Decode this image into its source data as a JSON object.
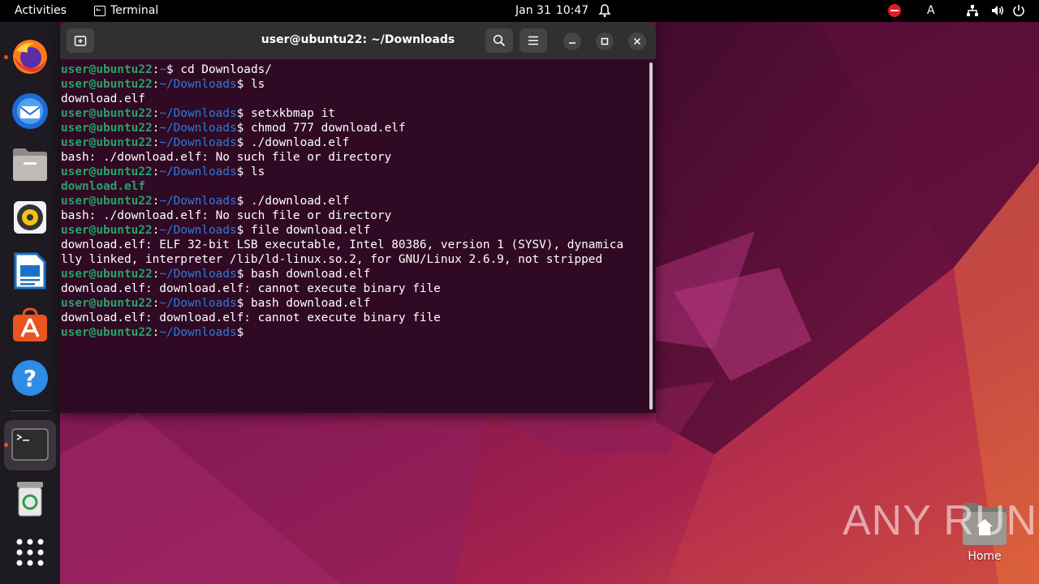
{
  "topbar": {
    "activities": "Activities",
    "app_name": "Terminal",
    "date": "Jan 31",
    "time": "10:47",
    "language": "A",
    "icons": [
      "bell-icon",
      "stop-icon",
      "network-icon",
      "volume-icon",
      "power-icon"
    ]
  },
  "dock": {
    "items": [
      "Firefox",
      "Thunderbird",
      "Files",
      "Rhythmbox",
      "LibreOffice Writer",
      "Ubuntu Software",
      "Help",
      "Terminal",
      "Trash",
      "Show Applications"
    ],
    "running": [
      "Firefox",
      "Terminal"
    ]
  },
  "terminal": {
    "title": "user@ubuntu22: ~/Downloads",
    "lines": [
      {
        "user": "user@ubuntu22",
        "colon": ":",
        "path": "~",
        "prompt": "$ ",
        "text": "cd Downloads/"
      },
      {
        "user": "user@ubuntu22",
        "colon": ":",
        "path": "~/Downloads",
        "prompt": "$ ",
        "text": "ls"
      },
      {
        "text": "download.elf"
      },
      {
        "user": "user@ubuntu22",
        "colon": ":",
        "path": "~/Downloads",
        "prompt": "$ ",
        "text": "setxkbmap it"
      },
      {
        "user": "user@ubuntu22",
        "colon": ":",
        "path": "~/Downloads",
        "prompt": "$ ",
        "text": "chmod 777 download.elf"
      },
      {
        "user": "user@ubuntu22",
        "colon": ":",
        "path": "~/Downloads",
        "prompt": "$ ",
        "text": "./download.elf"
      },
      {
        "text": "bash: ./download.elf: No such file or directory"
      },
      {
        "user": "user@ubuntu22",
        "colon": ":",
        "path": "~/Downloads",
        "prompt": "$ ",
        "text": "ls"
      },
      {
        "green": "download.elf"
      },
      {
        "user": "user@ubuntu22",
        "colon": ":",
        "path": "~/Downloads",
        "prompt": "$ ",
        "text": "./download.elf"
      },
      {
        "text": "bash: ./download.elf: No such file or directory"
      },
      {
        "user": "user@ubuntu22",
        "colon": ":",
        "path": "~/Downloads",
        "prompt": "$ ",
        "text": "file download.elf"
      },
      {
        "text": "download.elf: ELF 32-bit LSB executable, Intel 80386, version 1 (SYSV), dynamica"
      },
      {
        "text": "lly linked, interpreter /lib/ld-linux.so.2, for GNU/Linux 2.6.9, not stripped"
      },
      {
        "user": "user@ubuntu22",
        "colon": ":",
        "path": "~/Downloads",
        "prompt": "$ ",
        "text": "bash download.elf"
      },
      {
        "text": "download.elf: download.elf: cannot execute binary file"
      },
      {
        "user": "user@ubuntu22",
        "colon": ":",
        "path": "~/Downloads",
        "prompt": "$ ",
        "text": "bash download.elf"
      },
      {
        "text": "download.elf: download.elf: cannot execute binary file"
      },
      {
        "user": "user@ubuntu22",
        "colon": ":",
        "path": "~/Downloads",
        "prompt": "$",
        "text": ""
      }
    ]
  },
  "desktop": {
    "home_label": "Home",
    "watermark": "ANY RUN"
  },
  "colors": {
    "accent": "#e95420",
    "terminal_bg": "#300a24",
    "prompt_user": "#26a269",
    "prompt_path": "#2a7bde"
  }
}
